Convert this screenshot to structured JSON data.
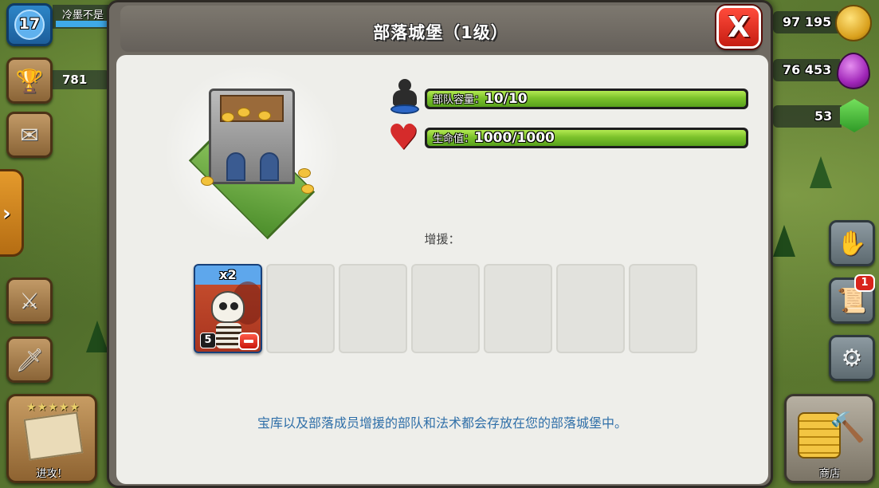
{
  "player": {
    "level": "17",
    "name": "冷墨不是",
    "trophies": "781"
  },
  "resources": {
    "gold": "97 195",
    "elixir": "76 453",
    "gems": "53"
  },
  "left_hud": {
    "attack_label": "进攻！",
    "attack_stars": "★★★★★"
  },
  "right_hud": {
    "shop_label": "商店",
    "notification_count": "1"
  },
  "modal": {
    "title": "部落城堡（1级）",
    "close_glyph": "X",
    "stats": [
      {
        "label": "部队容量：",
        "value": "10/10",
        "fill_fraction": 1.0
      },
      {
        "label": "生命值：",
        "value": "1000/1000",
        "fill_fraction": 1.0
      }
    ],
    "reinforcements_heading": "增援：",
    "units": [
      {
        "count": "x2",
        "level": "5"
      }
    ],
    "empty_slot_count": 6,
    "info_text": "宝库以及部落成员增援的部队和法术都会存放在您的部落城堡中。"
  },
  "colors": {
    "bar_fill": "#7cc22b",
    "close_button": "#e0281c",
    "info_text": "#2f6fa8"
  },
  "icons": {
    "troop": "troop-silhouette-icon",
    "health": "heart-icon",
    "gold": "gold-coin-icon",
    "elixir": "elixir-drop-icon",
    "gems": "gem-icon"
  }
}
